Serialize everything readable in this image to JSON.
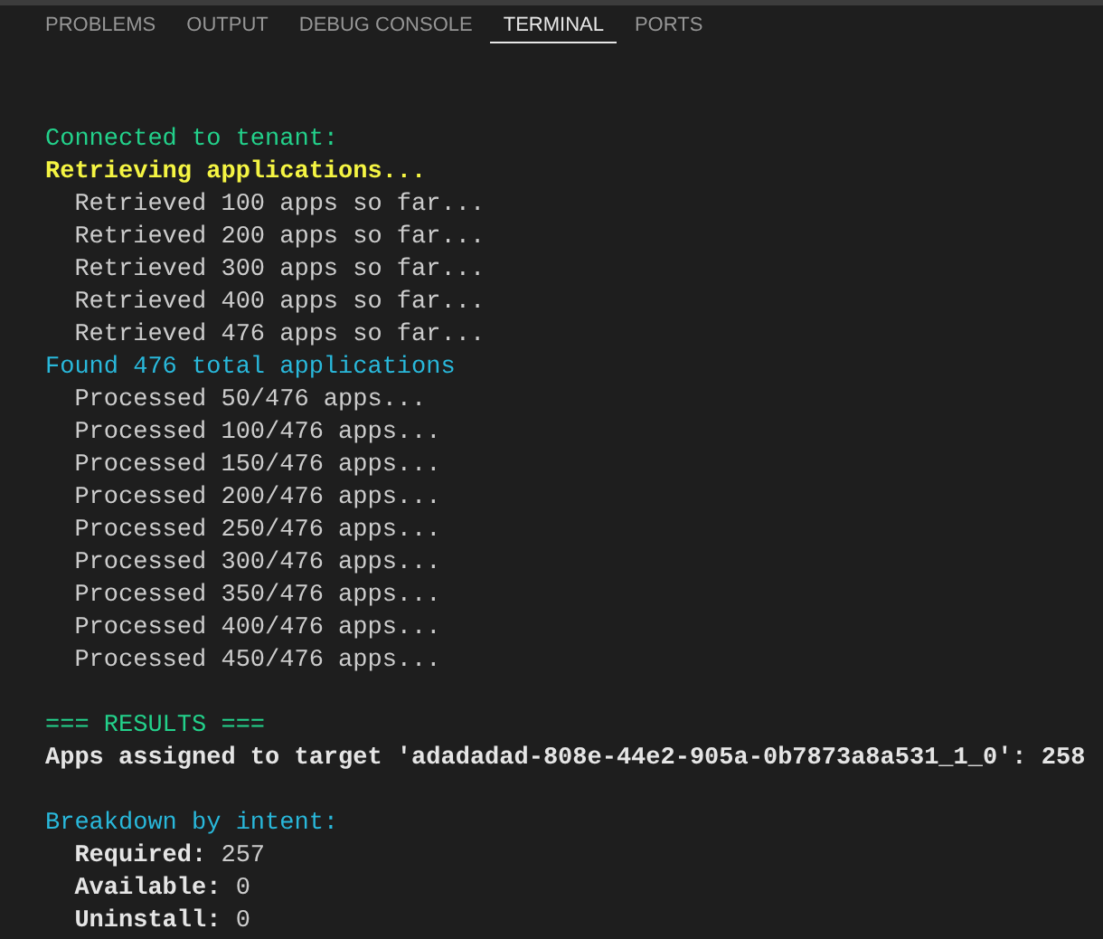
{
  "tabs": [
    {
      "label": "PROBLEMS",
      "selected": false
    },
    {
      "label": "OUTPUT",
      "selected": false
    },
    {
      "label": "DEBUG CONSOLE",
      "selected": false
    },
    {
      "label": "TERMINAL",
      "selected": true
    },
    {
      "label": "PORTS",
      "selected": false
    }
  ],
  "terminal": {
    "lines": [
      {
        "kind": "success",
        "text": "Connected to tenant:"
      },
      {
        "kind": "warning",
        "text": "Retrieving applications..."
      },
      {
        "kind": "plain",
        "text": "  Retrieved 100 apps so far..."
      },
      {
        "kind": "plain",
        "text": "  Retrieved 200 apps so far..."
      },
      {
        "kind": "plain",
        "text": "  Retrieved 300 apps so far..."
      },
      {
        "kind": "plain",
        "text": "  Retrieved 400 apps so far..."
      },
      {
        "kind": "plain",
        "text": "  Retrieved 476 apps so far..."
      },
      {
        "kind": "info",
        "text": "Found 476 total applications"
      },
      {
        "kind": "plain",
        "text": "  Processed 50/476 apps..."
      },
      {
        "kind": "plain",
        "text": "  Processed 100/476 apps..."
      },
      {
        "kind": "plain",
        "text": "  Processed 150/476 apps..."
      },
      {
        "kind": "plain",
        "text": "  Processed 200/476 apps..."
      },
      {
        "kind": "plain",
        "text": "  Processed 250/476 apps..."
      },
      {
        "kind": "plain",
        "text": "  Processed 300/476 apps..."
      },
      {
        "kind": "plain",
        "text": "  Processed 350/476 apps..."
      },
      {
        "kind": "plain",
        "text": "  Processed 400/476 apps..."
      },
      {
        "kind": "plain",
        "text": "  Processed 450/476 apps..."
      },
      {
        "kind": "blank"
      },
      {
        "kind": "success",
        "text": "=== RESULTS ==="
      },
      {
        "kind": "bold",
        "text": "Apps assigned to target 'adadadad-808e-44e2-905a-0b7873a8a531_1_0': 258"
      },
      {
        "kind": "blank"
      },
      {
        "kind": "info",
        "text": "Breakdown by intent:"
      },
      {
        "kind": "pair",
        "label": "  Required:",
        "value": "257"
      },
      {
        "kind": "pair",
        "label": "  Available:",
        "value": "0"
      },
      {
        "kind": "pair",
        "label": "  Uninstall:",
        "value": "0"
      }
    ]
  }
}
